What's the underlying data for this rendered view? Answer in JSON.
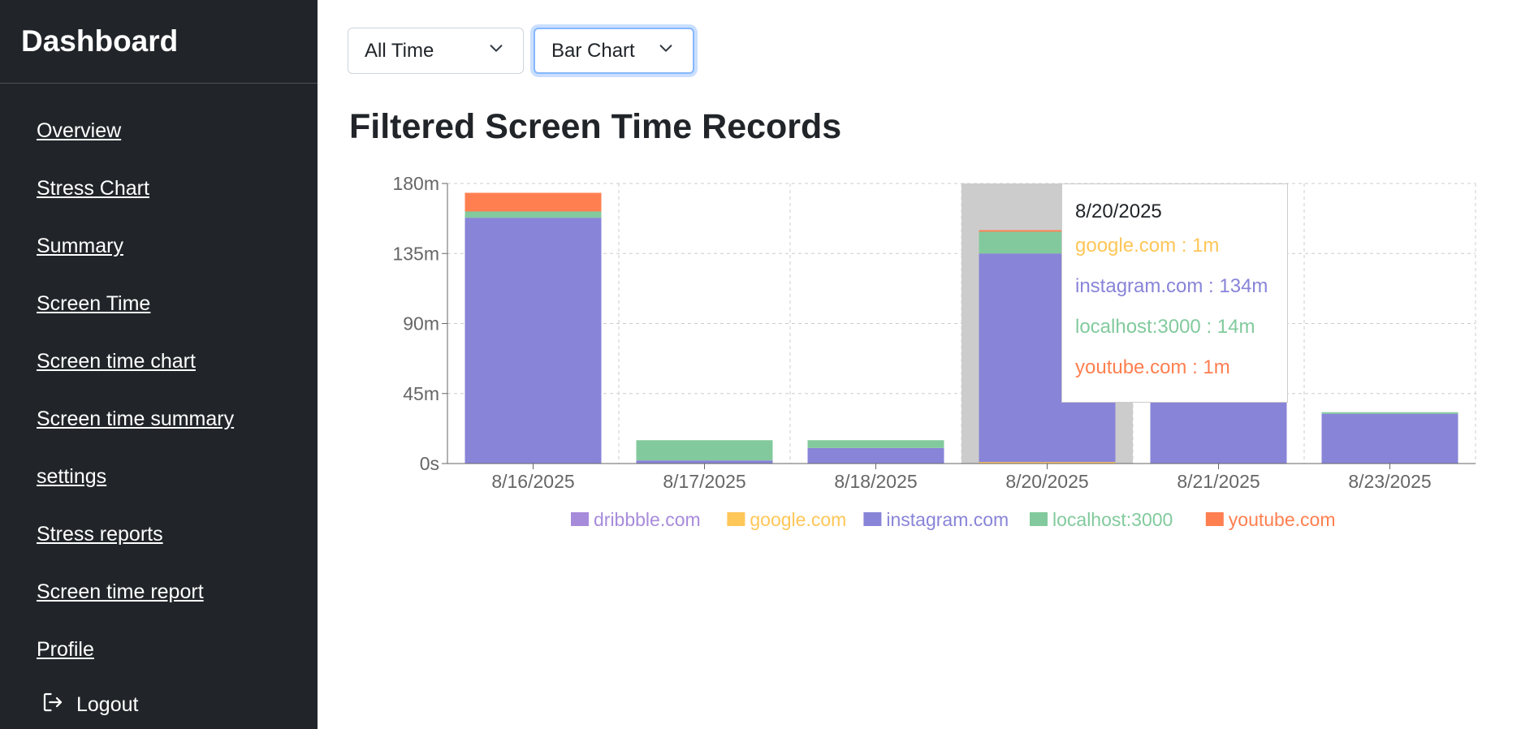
{
  "sidebar": {
    "brand": "Dashboard",
    "items": [
      {
        "label": "Overview"
      },
      {
        "label": "Stress Chart"
      },
      {
        "label": "Summary"
      },
      {
        "label": "Screen Time"
      },
      {
        "label": "Screen time chart"
      },
      {
        "label": "Screen time summary"
      },
      {
        "label": "settings"
      },
      {
        "label": "Stress reports"
      },
      {
        "label": "Screen time report"
      },
      {
        "label": "Profile"
      }
    ],
    "logout": {
      "label": "Logout",
      "icon": "logout-icon"
    }
  },
  "filters": {
    "range": {
      "value": "All Time",
      "icon": "chevron-down-icon"
    },
    "chart_type": {
      "value": "Bar Chart",
      "icon": "chevron-down-icon"
    }
  },
  "page_title": "Filtered Screen Time Records",
  "chart_data": {
    "type": "bar",
    "stacked": true,
    "categories": [
      "8/16/2025",
      "8/17/2025",
      "8/18/2025",
      "8/20/2025",
      "8/21/2025",
      "8/23/2025"
    ],
    "y_ticks": [
      "0s",
      "45m",
      "90m",
      "135m",
      "180m"
    ],
    "ylim": [
      0,
      180
    ],
    "grid": true,
    "legend_position": "bottom",
    "highlighted_category": "8/20/2025",
    "series": [
      {
        "name": "dribbble.com",
        "color": "#a78bdb",
        "values": [
          0,
          0,
          0,
          0,
          0,
          0
        ]
      },
      {
        "name": "google.com",
        "color": "#ffc658",
        "values": [
          0,
          0,
          0,
          1,
          0,
          0
        ]
      },
      {
        "name": "instagram.com",
        "color": "#8884d8",
        "values": [
          158,
          2,
          10,
          134,
          66,
          32
        ]
      },
      {
        "name": "localhost:3000",
        "color": "#82ca9d",
        "values": [
          4,
          13,
          5,
          14,
          20,
          1
        ]
      },
      {
        "name": "youtube.com",
        "color": "#ff7f50",
        "values": [
          12,
          0,
          0,
          1,
          0,
          0
        ]
      }
    ]
  },
  "tooltip": {
    "date": "8/20/2025",
    "rows": [
      {
        "text": "google.com : 1m",
        "color": "#ffc658"
      },
      {
        "text": "instagram.com : 134m",
        "color": "#8884d8"
      },
      {
        "text": "localhost:3000 : 14m",
        "color": "#82ca9d"
      },
      {
        "text": "youtube.com : 1m",
        "color": "#ff7f50"
      }
    ]
  }
}
